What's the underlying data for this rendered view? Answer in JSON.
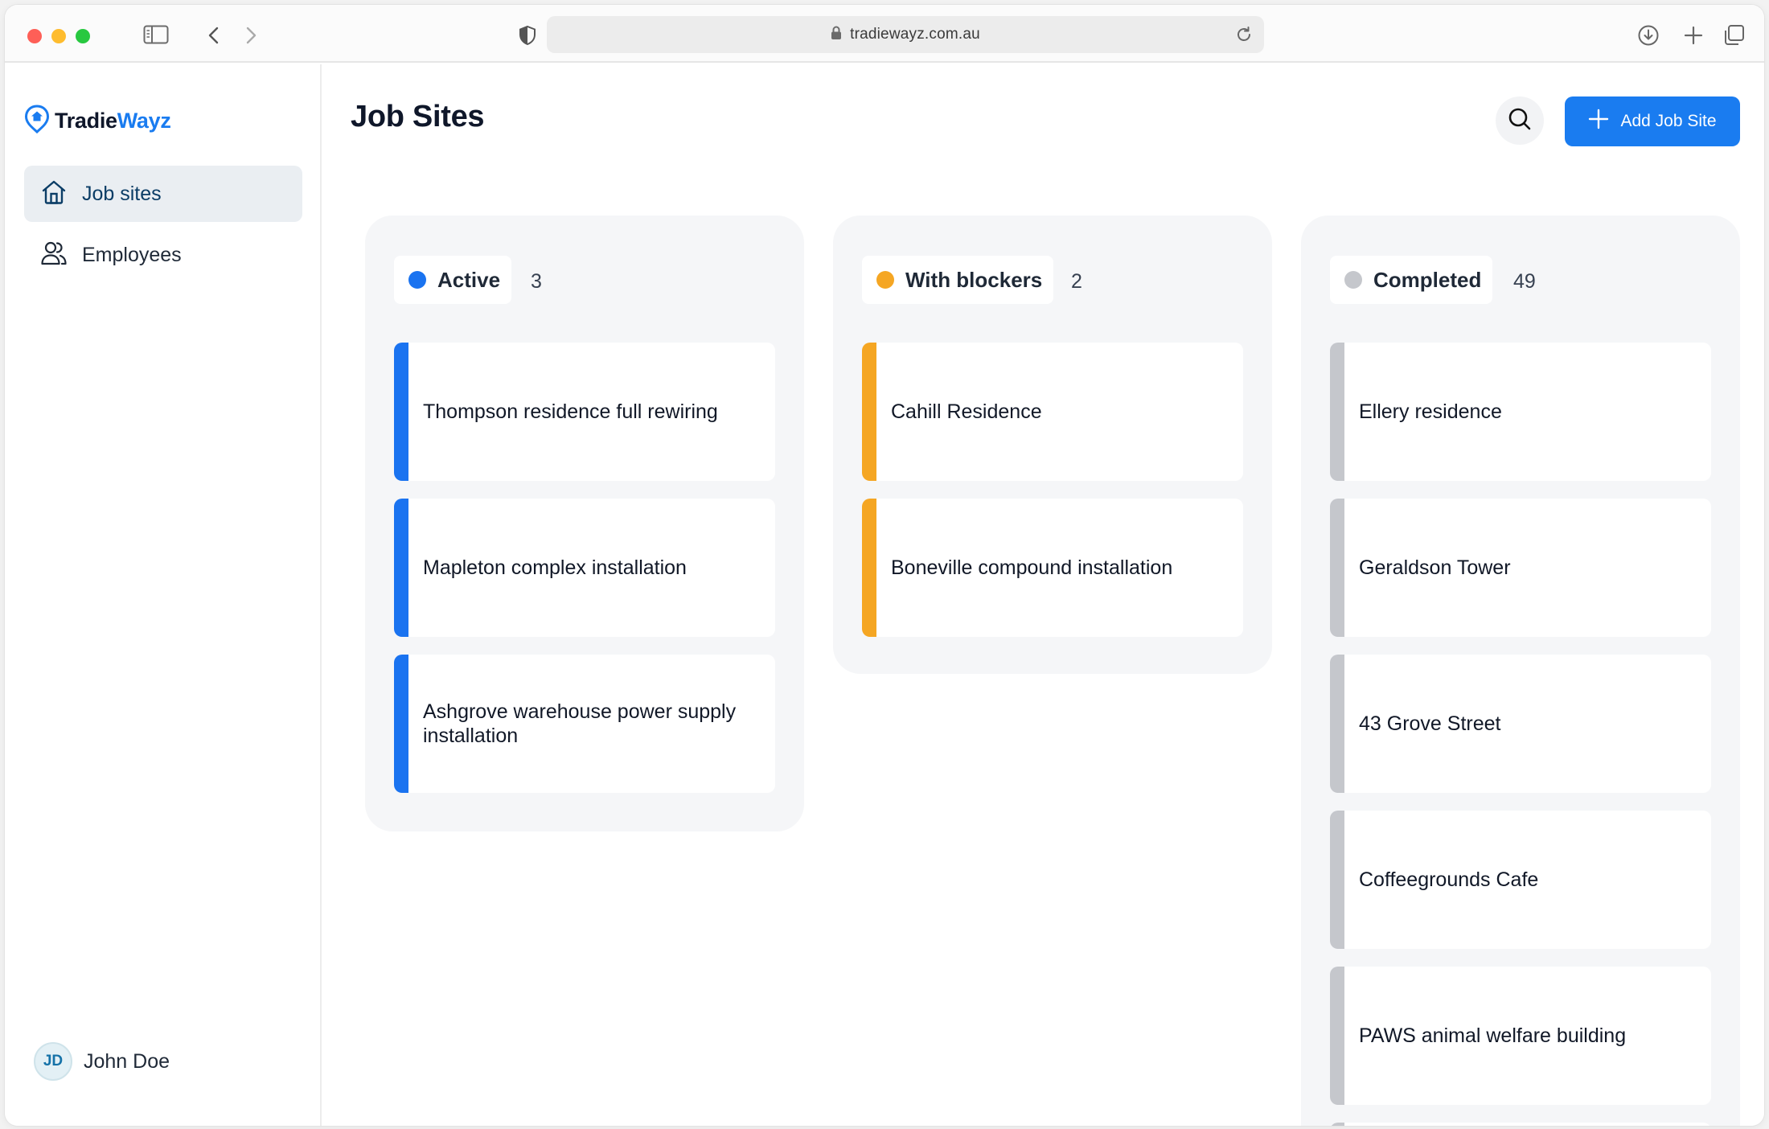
{
  "browser": {
    "url": "tradiewayz.com.au"
  },
  "app": {
    "logo_part1": "Tradie",
    "logo_part2": "Wayz",
    "brand_color": "#1a7cf0"
  },
  "sidebar": {
    "items": [
      {
        "label": "Job sites",
        "icon": "home-icon",
        "active": true
      },
      {
        "label": "Employees",
        "icon": "users-icon",
        "active": false
      }
    ],
    "user": {
      "initials": "JD",
      "name": "John Doe"
    }
  },
  "header": {
    "title": "Job Sites",
    "add_button_label": "Add Job Site"
  },
  "columns": [
    {
      "title": "Active",
      "count": "3",
      "color": "#1a73f0",
      "cards": [
        "Thompson residence full rewiring",
        "Mapleton complex installation",
        "Ashgrove warehouse power supply installation"
      ]
    },
    {
      "title": "With blockers",
      "count": "2",
      "color": "#f5a623",
      "cards": [
        "Cahill Residence",
        "Boneville compound installation"
      ]
    },
    {
      "title": "Completed",
      "count": "49",
      "color": "#c5c7cc",
      "cards": [
        "Ellery residence",
        "Geraldson Tower",
        "43 Grove Street",
        "Coffeegrounds Cafe",
        "PAWS animal welfare building"
      ]
    }
  ]
}
